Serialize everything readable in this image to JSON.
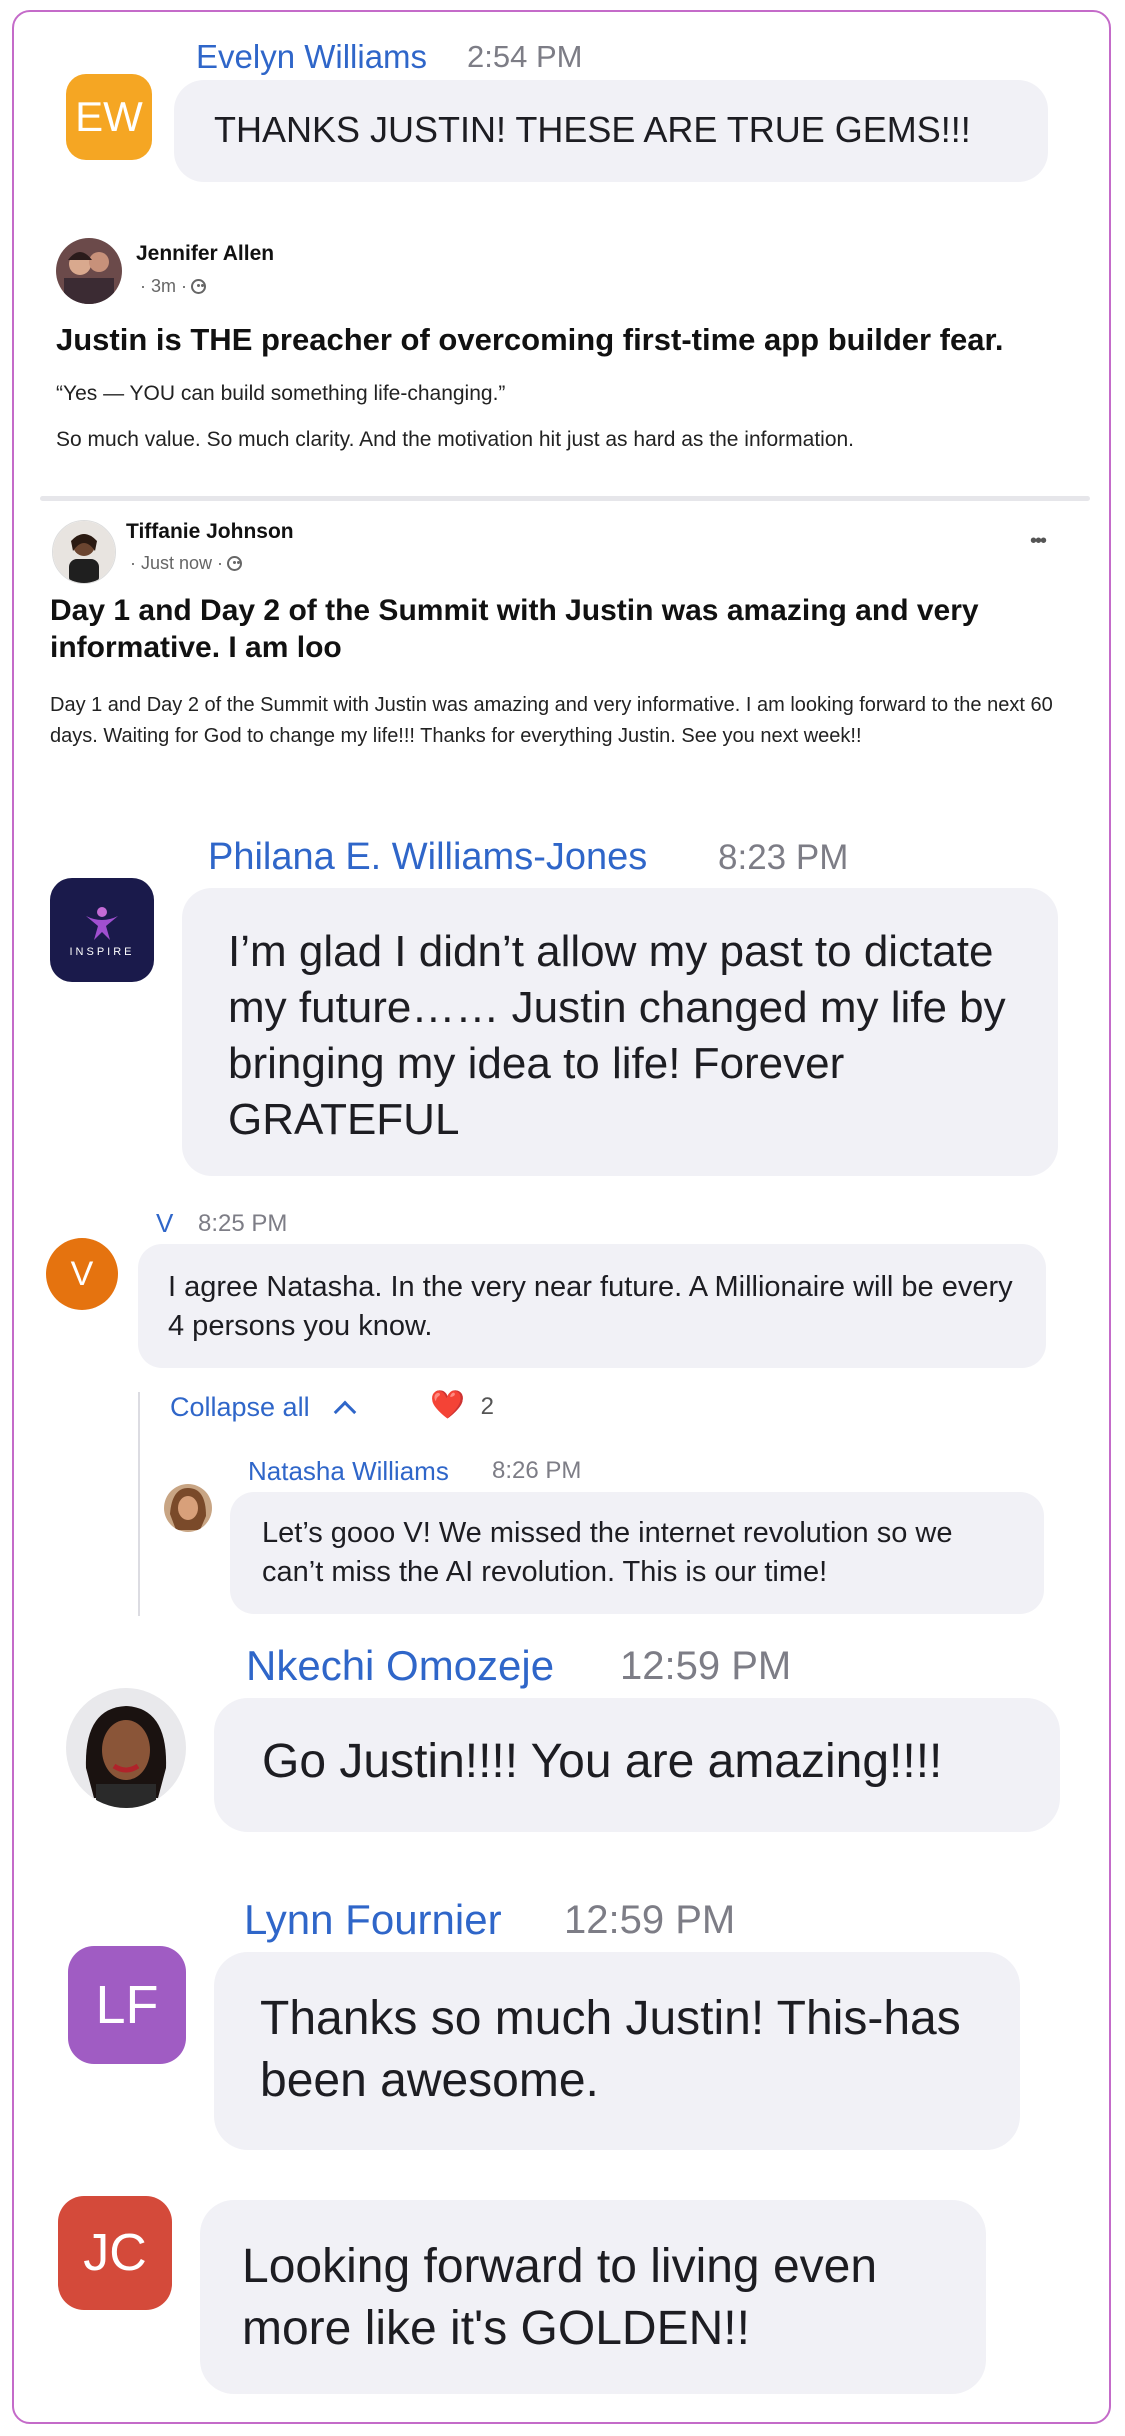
{
  "messages": {
    "evelyn": {
      "initials": "EW",
      "name": "Evelyn Williams",
      "time": "2:54 PM",
      "text": "THANKS JUSTIN! THESE ARE TRUE GEMS!!!",
      "color": "#f5a623"
    },
    "philana": {
      "name": "Philana E. Williams-Jones",
      "time": "8:23 PM",
      "text": "I’m glad I didn’t allow my past to dictate my future…… Justin changed my life by bringing my idea to life! Forever GRATEFUL",
      "logo_text": "INSPIRE",
      "logo_bg": "#1a1a4b"
    },
    "v": {
      "initials": "V",
      "name": "V",
      "time": "8:25 PM",
      "text": "I agree Natasha.  In the very near future.  A Millionaire will be every 4 persons you know.",
      "color": "#e5730f"
    },
    "thread": {
      "collapse_label": "Collapse all",
      "reaction_emoji": "❤️",
      "reaction_count": "2"
    },
    "natasha": {
      "name": "Natasha Williams",
      "time": "8:26 PM",
      "text": "Let’s gooo V! We missed the internet revolution so we can’t miss the AI revolution. This is our time!"
    },
    "nkechi": {
      "name": "Nkechi Omozeje",
      "time": "12:59 PM",
      "text": "Go Justin!!!! You are amazing!!!!"
    },
    "lynn": {
      "initials": "LF",
      "name": "Lynn Fournier",
      "time": "12:59 PM",
      "text": "Thanks so much Justin!  This-has been awesome.",
      "color": "#a05cc3"
    },
    "jc": {
      "initials": "JC",
      "text": "Looking forward to living even more like it's GOLDEN!!",
      "color": "#d44a3a"
    }
  },
  "posts": {
    "jennifer": {
      "author": "Jennifer Allen",
      "meta": "· 3m ·",
      "title": "Justin is THE preacher of overcoming first-time app builder fear.",
      "quote": "“Yes — YOU can build something life-changing.”",
      "body": "So much value. So much clarity. And the motivation hit just as hard as the information."
    },
    "tiffanie": {
      "author": "Tiffanie Johnson",
      "meta": "· Just now ·",
      "more": "•••",
      "title": "Day 1 and Day 2 of the Summit with Justin was amazing and very informative. I am loo",
      "body": "Day 1 and Day 2 of the Summit with Justin was amazing and very informative. I am looking forward to the next 60 days. Waiting for God to change my life!!! Thanks for everything Justin. See you next week!!"
    }
  }
}
